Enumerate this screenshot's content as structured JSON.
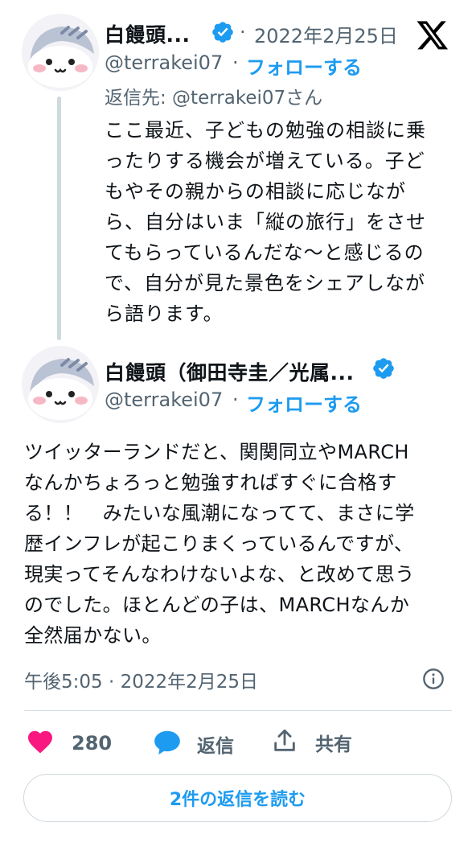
{
  "tweet1": {
    "display_name": "白饅頭...",
    "date": "2022年2月25日",
    "handle": "@terrakei07",
    "follow_label": "フォローする",
    "reply_to": "返信先: @terrakei07さん",
    "text_lines": [
      "ここ最近、子どもの勉強の相談に乗",
      "ったりする機会が増えている。子ど",
      "もやその親からの相談に応じなが",
      "ら、自分はいま「縦の旅行」をさせ",
      "てもらっているんだな〜と感じるの",
      "で、自分が見た景色をシェアしなが",
      "ら語ります。"
    ]
  },
  "tweet2": {
    "display_name": "白饅頭（御田寺圭／光属...",
    "handle": "@terrakei07",
    "follow_label": "フォローする",
    "text_lines": [
      "ツイッターランドだと、関関同立やMARCH",
      "なんかちょろっと勉強すればすぐに合格す",
      "る！！　みたいな風潮になってて、まさに学",
      "歴インフレが起こりまくっているんですが、",
      "現実ってそんなわけないよな、と改めて思う",
      "のでした。ほとんどの子は、MARCHなんか",
      "全然届かない。"
    ],
    "timestamp": "午後5:05 · 2022年2月25日"
  },
  "actions": {
    "like_count": "280",
    "reply_label": "返信",
    "share_label": "共有"
  },
  "read_replies_label": "2件の返信を読む",
  "colors": {
    "accent": "#1d9bf0",
    "like": "#f91880",
    "muted": "#536471"
  },
  "icons": [
    "x-logo-icon",
    "verified-badge-icon",
    "info-icon",
    "heart-icon",
    "speech-bubble-icon",
    "share-icon"
  ]
}
